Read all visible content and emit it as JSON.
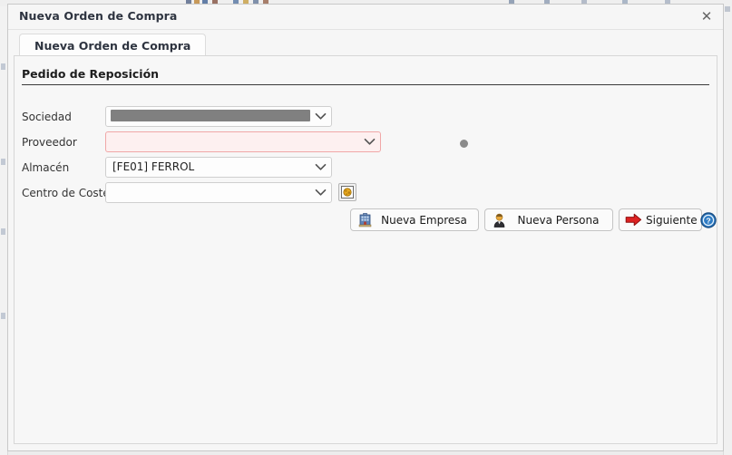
{
  "window": {
    "title": "Nueva Orden de Compra",
    "close_label": "✕",
    "close_icon": "close-icon"
  },
  "tabs": [
    {
      "label": "Nueva Orden de Compra",
      "active": true
    }
  ],
  "panel": {
    "section_heading": "Pedido de Reposición"
  },
  "form": {
    "fields": [
      {
        "label": "Sociedad",
        "value": "",
        "redacted": true,
        "state": "normal",
        "arrow_icon": "chevron-down-icon"
      },
      {
        "label": "Proveedor",
        "value": "",
        "redacted": false,
        "state": "invalid",
        "arrow_icon": "chevron-down-icon"
      },
      {
        "label": "Almacén",
        "value": "[FE01] FERROL",
        "redacted": false,
        "state": "normal",
        "arrow_icon": "chevron-down-icon"
      },
      {
        "label": "Centro de Coste",
        "value": "",
        "redacted": false,
        "state": "normal",
        "arrow_icon": "chevron-down-icon"
      }
    ],
    "centro_browse_icon": "browse-lookup-icon",
    "busy_indicator_icon": "gray-dot-indicator"
  },
  "actions": [
    {
      "label": "Nueva Empresa",
      "icon": "building-icon"
    },
    {
      "label": "Nueva Persona",
      "icon": "person-icon"
    },
    {
      "label": "Siguiente",
      "icon": "red-arrow-right-icon"
    }
  ],
  "help": {
    "icon": "help-question-icon",
    "tooltip": "?"
  },
  "colors": {
    "dialog_bg": "#f6f6f6",
    "panel_bg": "#f7f7f7",
    "invalid_border": "#f0a7a7",
    "invalid_bg": "#fdf0f0",
    "redaction": "#808080",
    "help_blue": "#1a6fb5",
    "arrow_red": "#d92121"
  }
}
